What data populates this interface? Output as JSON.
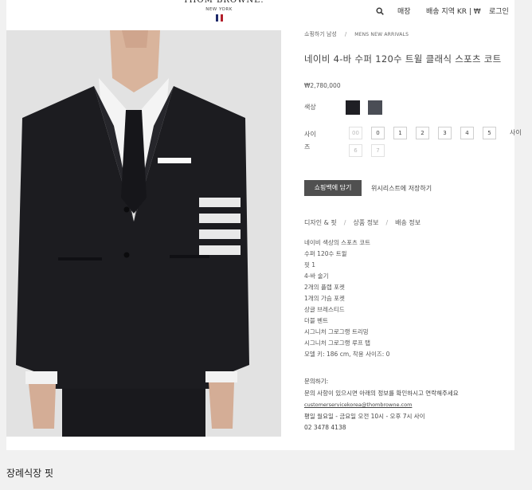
{
  "header": {
    "logo": "THOM BROWNE.",
    "logo_sub": "NEW YORK",
    "store_link": "매장",
    "region_link": "배송 지역 KR | ₩",
    "login_link": "로그인"
  },
  "breadcrumb": [
    "쇼핑하기 남성",
    "MENS NEW ARRIVALS"
  ],
  "product": {
    "title": "네이비 4-바 수퍼 120수 트윌 클래식 스포츠 코트",
    "price": "₩2,780,000",
    "color_label": "색상",
    "swatch_colors": [
      "#1f1f24",
      "#4a4d55"
    ],
    "size_label": "사이즈",
    "size_label_right": "사이",
    "sizes": [
      "00",
      "0",
      "1",
      "2",
      "3",
      "4",
      "5"
    ],
    "sizes_row2": [
      "6",
      "7"
    ],
    "add_to_cart": "쇼핑백에 담기",
    "wishlist": "위시리스트에 저장하기"
  },
  "tabs": [
    "디자인 & 핏",
    "상품 정보",
    "배송 정보"
  ],
  "description": [
    "네이비 색상의 스포츠 코트",
    "수퍼 120수 트윌",
    "핏 1",
    "4-바 술기",
    "2개의 플랩 포켓",
    "1개의 가슴 포켓",
    "상글 브레스티드",
    "더블 벤트",
    "시그니처 그로그랭 트리밍",
    "시그니처 그로그랭 루프 탭",
    "모델 키: 186 cm, 착용 사이즈: 0"
  ],
  "contact": {
    "heading": "문의하기:",
    "text": "문의 사항이 있으시면 아래의 정보를 확인하시고 연락해주세요",
    "email": "customerservicekorea@thombrowne.com",
    "hours": "평일 월요일 - 금요일 오전 10시 - 오후 7시 사이",
    "phone": "02 3478 4138"
  },
  "section_title": "장례식장 핏"
}
